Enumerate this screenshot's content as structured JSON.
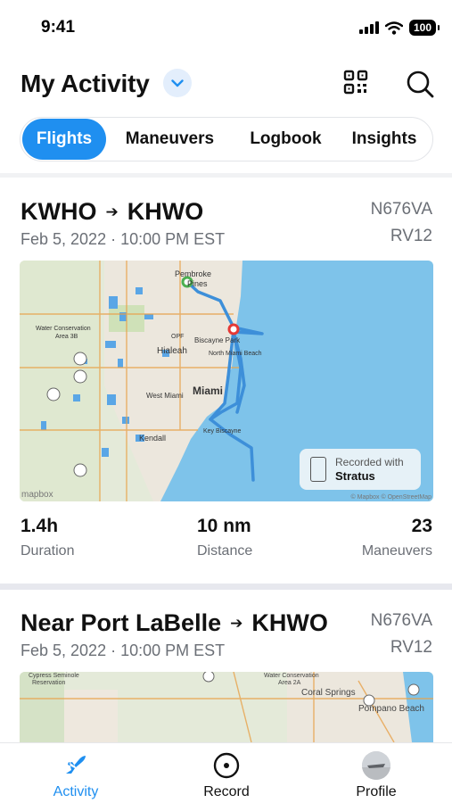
{
  "status": {
    "time": "9:41",
    "battery": "100"
  },
  "header": {
    "title": "My Activity"
  },
  "tabs": [
    {
      "label": "Flights",
      "active": true
    },
    {
      "label": "Maneuvers",
      "active": false
    },
    {
      "label": "Logbook",
      "active": false
    },
    {
      "label": "Insights",
      "active": false
    }
  ],
  "flights": [
    {
      "from": "KWHO",
      "to": "KHWO",
      "date": "Feb 5, 2022 · 10:00 PM EST",
      "tail": "N676VA",
      "model": "RV12",
      "map": {
        "labels": [
          "Pembroke",
          "Pines",
          "Water Conservation",
          "Area 3B",
          "OPF",
          "Biscayne Park",
          "Hialeah",
          "North Miami Beach",
          "Miami",
          "West Miami",
          "Key Biscayne",
          "Kendall"
        ],
        "recorded_with": "Recorded with",
        "recorder": "Stratus",
        "logo": "mapbox",
        "attribution": "© Mapbox © OpenStreetMap"
      },
      "stats": {
        "duration_value": "1.4h",
        "duration_label": "Duration",
        "distance_value": "10 nm",
        "distance_label": "Distance",
        "maneuvers_value": "23",
        "maneuvers_label": "Maneuvers"
      }
    },
    {
      "from": "Near Port LaBelle",
      "to": "KHWO",
      "date": "Feb 5, 2022 · 10:00 PM EST",
      "tail": "N676VA",
      "model": "RV12",
      "map": {
        "labels": [
          "Cypress Seminole",
          "Reservation",
          "Water Conservation",
          "Area 2A",
          "Coral Springs",
          "Pompano Beach"
        ]
      }
    }
  ],
  "bottom_nav": [
    {
      "label": "Activity",
      "active": true
    },
    {
      "label": "Record",
      "active": false
    },
    {
      "label": "Profile",
      "active": false
    }
  ],
  "colors": {
    "accent": "#1f8ff0",
    "water": "#7ec3ea",
    "track": "#3d8fd9",
    "start": "#4caf50",
    "end": "#e53935"
  }
}
